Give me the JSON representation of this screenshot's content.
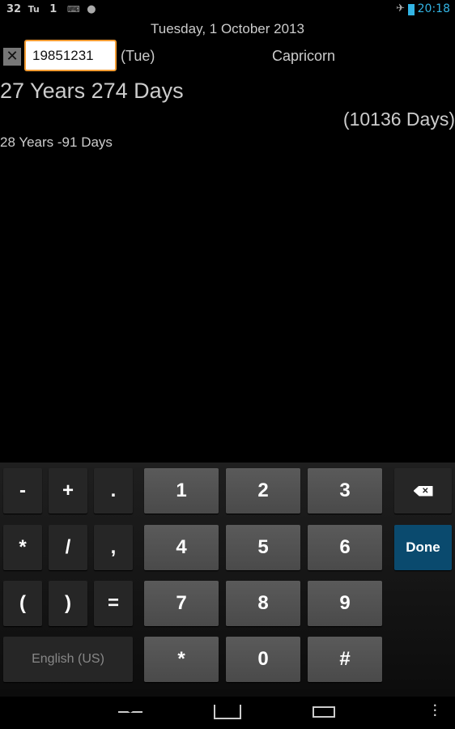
{
  "status": {
    "left_items": [
      "32",
      "Tu",
      "1"
    ],
    "icons": [
      "keyboard-icon",
      "android-icon",
      "airplane-icon",
      "battery-charging-icon"
    ],
    "time": "20:18",
    "time_color": "#33b5e5"
  },
  "header": {
    "date": "Tuesday, 1 October 2013"
  },
  "input": {
    "value": "19851231",
    "weekday": "(Tue)",
    "zodiac": "Capricorn",
    "accent": "#f39c33"
  },
  "result": {
    "age": "27 Years 274 Days",
    "total_days": "(10136 Days)",
    "next": "28 Years -91 Days"
  },
  "keyboard": {
    "symbols": [
      "-",
      "+",
      ".",
      "*",
      "/",
      ",",
      "(",
      ")",
      "="
    ],
    "digits": [
      "1",
      "2",
      "3",
      "4",
      "5",
      "6",
      "7",
      "8",
      "9",
      "*",
      "0",
      "#"
    ],
    "language": "English (US)",
    "done": "Done",
    "done_color": "#0a4a6e"
  },
  "nav": {
    "icons": [
      "back-icon",
      "home-icon",
      "recents-icon",
      "menu-icon"
    ]
  }
}
